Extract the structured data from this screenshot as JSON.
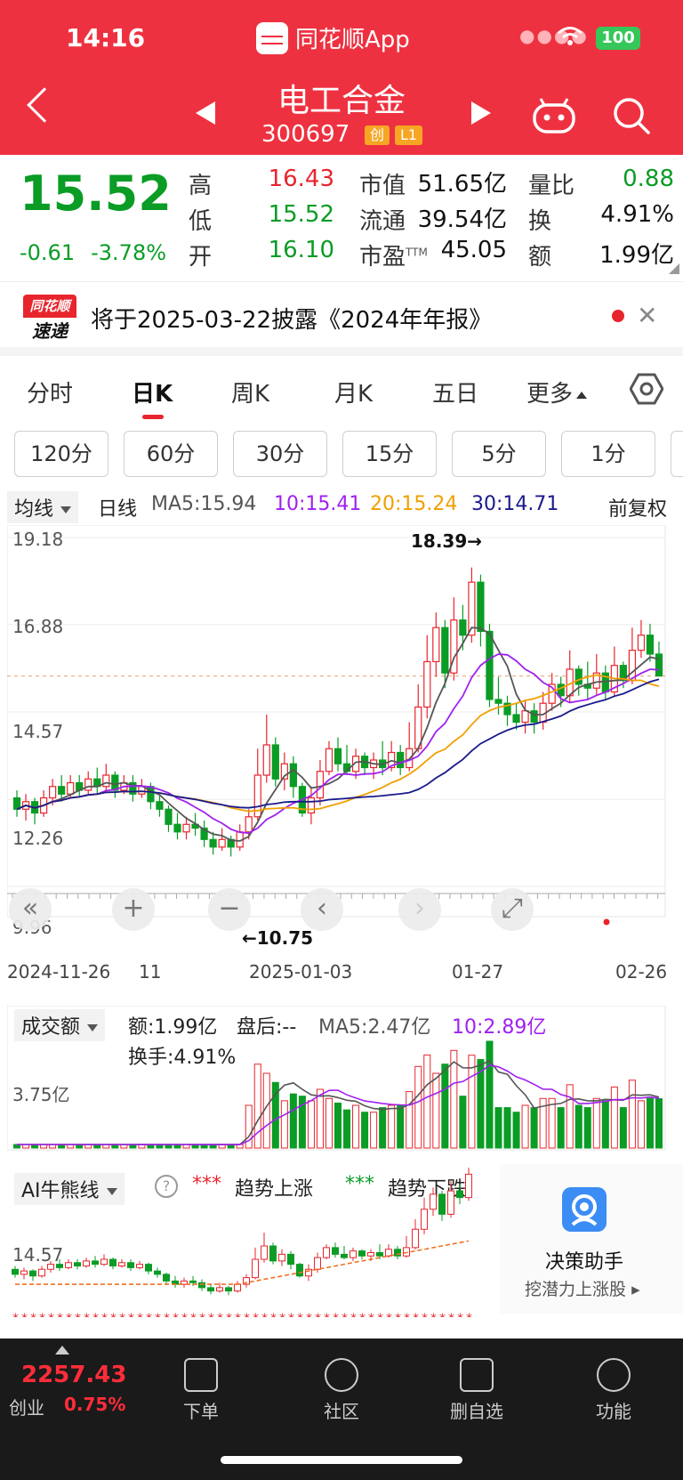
{
  "status": {
    "time": "14:16",
    "app_name": "同花顺App",
    "battery": "100"
  },
  "header": {
    "stock_name": "电工合金",
    "stock_code": "300697",
    "badge_board": "创",
    "badge_level": "L1"
  },
  "quote": {
    "price": "15.52",
    "change": "-0.61",
    "change_pct": "-3.78%",
    "high_label": "高",
    "high": "16.43",
    "low_label": "低",
    "low": "15.52",
    "open_label": "开",
    "open": "16.10",
    "mcap_label": "市值",
    "mcap": "51.65亿",
    "float_label": "流通",
    "float": "39.54亿",
    "pe_label": "市盈",
    "pe_sup": "TTM",
    "pe": "45.05",
    "vr_label": "量比",
    "vr": "0.88",
    "turn_label": "换",
    "turn": "4.91%",
    "amt_label": "额",
    "amt": "1.99亿"
  },
  "notice": {
    "logo_top": "同花顺",
    "logo_bottom": "速递",
    "text": "将于2025-03-22披露《2024年年报》"
  },
  "tabs": [
    "分时",
    "日K",
    "周K",
    "月K",
    "五日",
    "更多"
  ],
  "minute_buttons": [
    "120分",
    "60分",
    "30分",
    "15分",
    "5分",
    "1分"
  ],
  "ma_bar": {
    "selector": "均线",
    "period": "日线",
    "ma5": "MA5:15.94",
    "ma10": "10:15.41",
    "ma20": "20:15.24",
    "ma30": "30:14.71",
    "adjust": "前复权"
  },
  "colors": {
    "up": "#e8252d",
    "down": "#0a9c25",
    "ma5": "#555555",
    "ma10": "#a020f0",
    "ma20": "#f0a000",
    "ma30": "#1a1a8c",
    "brand": "#ee3140"
  },
  "kline": {
    "y_labels": [
      "19.18",
      "16.88",
      "14.57",
      "12.26",
      "9.96"
    ],
    "high_note": "18.39→",
    "low_note": "←10.75",
    "x_labels": [
      "2024-11-26",
      "11",
      "2025-01-03",
      "01-27",
      "02-26"
    ],
    "chart_data": {
      "type": "candlestick",
      "ylim": [
        9.96,
        19.18
      ],
      "candles": [
        [
          12.3,
          12.0,
          12.5,
          11.8
        ],
        [
          12.0,
          12.2,
          12.4,
          11.7
        ],
        [
          12.2,
          11.9,
          12.3,
          11.6
        ],
        [
          11.9,
          12.3,
          12.5,
          11.8
        ],
        [
          12.3,
          12.6,
          12.8,
          12.1
        ],
        [
          12.6,
          12.4,
          12.9,
          12.2
        ],
        [
          12.4,
          12.7,
          12.9,
          12.3
        ],
        [
          12.7,
          12.5,
          12.9,
          12.3
        ],
        [
          12.5,
          12.8,
          13.0,
          12.4
        ],
        [
          12.8,
          12.6,
          13.1,
          12.4
        ],
        [
          12.6,
          12.9,
          13.2,
          12.5
        ],
        [
          12.9,
          12.5,
          13.0,
          12.3
        ],
        [
          12.5,
          12.7,
          12.9,
          12.4
        ],
        [
          12.7,
          12.4,
          12.9,
          12.2
        ],
        [
          12.4,
          12.6,
          12.8,
          12.3
        ],
        [
          12.6,
          12.2,
          12.7,
          12.0
        ],
        [
          12.2,
          12.0,
          12.4,
          11.8
        ],
        [
          12.0,
          11.6,
          12.1,
          11.4
        ],
        [
          11.6,
          11.4,
          11.9,
          11.2
        ],
        [
          11.4,
          11.6,
          11.8,
          11.2
        ],
        [
          11.6,
          11.5,
          11.9,
          11.3
        ],
        [
          11.5,
          11.2,
          11.7,
          11.0
        ],
        [
          11.2,
          11.0,
          11.4,
          10.8
        ],
        [
          11.0,
          11.2,
          11.5,
          10.9
        ],
        [
          11.2,
          11.0,
          11.3,
          10.75
        ],
        [
          11.0,
          11.4,
          11.6,
          10.9
        ],
        [
          11.4,
          11.8,
          12.0,
          11.2
        ],
        [
          11.8,
          12.9,
          13.6,
          11.7
        ],
        [
          12.9,
          13.7,
          14.5,
          12.7
        ],
        [
          13.7,
          12.8,
          13.9,
          12.6
        ],
        [
          12.8,
          13.2,
          13.5,
          12.5
        ],
        [
          13.2,
          12.6,
          13.4,
          12.3
        ],
        [
          12.6,
          11.9,
          12.7,
          11.8
        ],
        [
          11.9,
          12.3,
          12.6,
          11.6
        ],
        [
          12.3,
          13.0,
          13.3,
          12.1
        ],
        [
          13.0,
          13.6,
          13.8,
          12.9
        ],
        [
          13.6,
          13.2,
          13.9,
          13.0
        ],
        [
          13.2,
          13.0,
          13.7,
          12.9
        ],
        [
          13.0,
          13.4,
          13.6,
          12.8
        ],
        [
          13.4,
          13.1,
          13.5,
          12.9
        ],
        [
          13.1,
          13.3,
          13.5,
          12.8
        ],
        [
          13.3,
          13.1,
          13.8,
          12.9
        ],
        [
          13.1,
          13.5,
          13.8,
          13.0
        ],
        [
          13.5,
          13.1,
          13.7,
          12.9
        ],
        [
          13.1,
          13.6,
          14.3,
          13.0
        ],
        [
          13.6,
          14.7,
          15.3,
          13.5
        ],
        [
          14.7,
          15.9,
          16.6,
          14.4
        ],
        [
          15.9,
          16.8,
          17.2,
          15.5
        ],
        [
          16.8,
          15.6,
          17.0,
          15.2
        ],
        [
          15.6,
          17.0,
          17.6,
          15.4
        ],
        [
          17.0,
          16.6,
          17.4,
          16.2
        ],
        [
          16.6,
          18.0,
          18.39,
          16.4
        ],
        [
          18.0,
          16.7,
          18.2,
          16.3
        ],
        [
          16.7,
          14.9,
          16.9,
          14.7
        ],
        [
          14.9,
          14.8,
          15.5,
          14.5
        ],
        [
          14.8,
          14.5,
          15.0,
          14.2
        ],
        [
          14.5,
          14.3,
          14.8,
          14.1
        ],
        [
          14.3,
          14.6,
          14.9,
          14.0
        ],
        [
          14.6,
          14.3,
          14.8,
          14.0
        ],
        [
          14.3,
          14.8,
          15.1,
          14.1
        ],
        [
          14.8,
          15.3,
          15.6,
          14.6
        ],
        [
          15.3,
          15.0,
          15.5,
          14.7
        ],
        [
          15.0,
          15.7,
          16.2,
          14.8
        ],
        [
          15.7,
          15.3,
          15.8,
          15.0
        ],
        [
          15.3,
          15.2,
          15.9,
          14.9
        ],
        [
          15.2,
          15.6,
          16.1,
          15.0
        ],
        [
          15.6,
          15.1,
          15.8,
          14.9
        ],
        [
          15.1,
          15.8,
          16.3,
          15.0
        ],
        [
          15.8,
          15.4,
          15.9,
          15.2
        ],
        [
          15.4,
          16.2,
          16.8,
          15.3
        ],
        [
          16.2,
          16.6,
          17.0,
          16.0
        ],
        [
          16.6,
          16.1,
          16.9,
          15.9
        ],
        [
          16.1,
          15.52,
          16.43,
          15.52
        ]
      ]
    }
  },
  "volume": {
    "selector": "成交额",
    "amt": "额:1.99亿",
    "after": "盘后:--",
    "ma5": "MA5:2.47亿",
    "ma10": "10:2.89亿",
    "turnover": "换手:4.91%",
    "y_label": "3.75亿"
  },
  "ai": {
    "selector": "AI牛熊线",
    "help": "?",
    "up_legend": "趋势上涨",
    "down_legend": "趋势下跌",
    "y_label": "14.57"
  },
  "assistant": {
    "title": "决策助手",
    "subtitle": "挖潜力上涨股"
  },
  "nav": {
    "index_value": "2257.43",
    "index_name": "创业",
    "index_pct": "0.75%",
    "items": [
      "下单",
      "社区",
      "删自选",
      "功能"
    ]
  }
}
